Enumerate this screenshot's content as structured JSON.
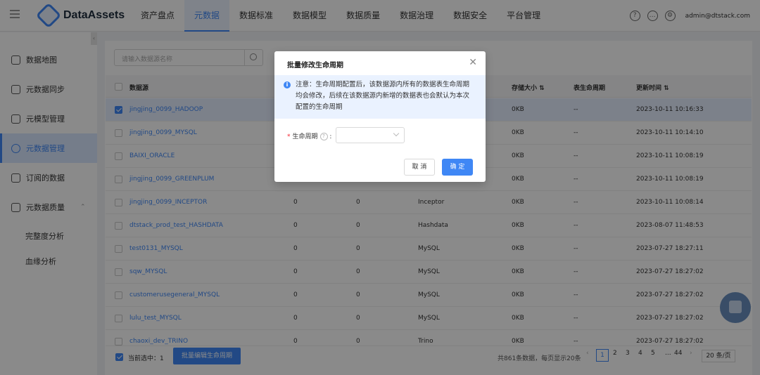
{
  "app": {
    "name": "DataAssets"
  },
  "nav": {
    "items": [
      "资产盘点",
      "元数据",
      "数据标准",
      "数据模型",
      "数据质量",
      "数据治理",
      "数据安全",
      "平台管理"
    ],
    "active_index": 1
  },
  "user": {
    "email": "admin@dtstack.com"
  },
  "sidebar": {
    "items": [
      {
        "label": "数据地图",
        "icon": "map-icon"
      },
      {
        "label": "元数据同步",
        "icon": "sync-icon"
      },
      {
        "label": "元模型管理",
        "icon": "cube-icon"
      },
      {
        "label": "元数据管理",
        "icon": "database-icon"
      },
      {
        "label": "订阅的数据",
        "icon": "subscribe-icon"
      },
      {
        "label": "元数据质量",
        "icon": "shield-icon"
      }
    ],
    "active_index": 3,
    "sub_items": [
      "完整度分析",
      "血缘分析"
    ]
  },
  "search": {
    "placeholder": "请输入数据源名称"
  },
  "table": {
    "columns": {
      "source": "数据源",
      "storage": "存储大小",
      "lifecycle": "表生命周期",
      "updated": "更新时间"
    },
    "rows": [
      {
        "name": "jingjing_0099_HADOOP",
        "c1": "",
        "c2": "",
        "type": "",
        "size": "0KB",
        "life": "--",
        "time": "2023-10-11 10:16:33",
        "checked": true
      },
      {
        "name": "jingjing_0099_MYSQL",
        "c1": "",
        "c2": "",
        "type": "",
        "size": "0KB",
        "life": "--",
        "time": "2023-10-11 10:14:10",
        "checked": false
      },
      {
        "name": "BAIXI_ORACLE",
        "c1": "",
        "c2": "",
        "type": "",
        "size": "0KB",
        "life": "--",
        "time": "2023-10-11 10:08:19",
        "checked": false
      },
      {
        "name": "jingjing_0099_GREENPLUM",
        "c1": "",
        "c2": "",
        "type": "",
        "size": "0KB",
        "life": "--",
        "time": "2023-10-11 10:08:19",
        "checked": false
      },
      {
        "name": "jingjing_0099_INCEPTOR",
        "c1": "0",
        "c2": "0",
        "type": "Inceptor",
        "size": "0KB",
        "life": "--",
        "time": "2023-10-11 10:08:14",
        "checked": false
      },
      {
        "name": "dtstack_prod_test_HASHDATA",
        "c1": "0",
        "c2": "0",
        "type": "Hashdata",
        "size": "0KB",
        "life": "--",
        "time": "2023-08-07 11:48:53",
        "checked": false
      },
      {
        "name": "test0131_MYSQL",
        "c1": "0",
        "c2": "0",
        "type": "MySQL",
        "size": "0KB",
        "life": "--",
        "time": "2023-07-27 18:27:11",
        "checked": false
      },
      {
        "name": "sqw_MYSQL",
        "c1": "0",
        "c2": "0",
        "type": "MySQL",
        "size": "0KB",
        "life": "--",
        "time": "2023-07-27 18:27:02",
        "checked": false
      },
      {
        "name": "customerusegeneral_MYSQL",
        "c1": "0",
        "c2": "0",
        "type": "MySQL",
        "size": "0KB",
        "life": "--",
        "time": "2023-07-27 18:27:02",
        "checked": false
      },
      {
        "name": "lulu_test_MYSQL",
        "c1": "0",
        "c2": "0",
        "type": "MySQL",
        "size": "0KB",
        "life": "--",
        "time": "2023-07-27 18:27:02",
        "checked": false
      },
      {
        "name": "chaoxi_dev_TRINO",
        "c1": "0",
        "c2": "0",
        "type": "Trino",
        "size": "0KB",
        "life": "--",
        "time": "2023-07-27 18:27:02",
        "checked": false
      }
    ]
  },
  "footer": {
    "selected": "当前选中：1",
    "batch_button": "批量编辑生命周期",
    "summary": "共861条数据，每页显示20条",
    "pages": [
      "1",
      "2",
      "3",
      "4",
      "5",
      "...",
      "44"
    ],
    "page_size": "20 条/页"
  },
  "modal": {
    "title": "批量修改生命周期",
    "notice": "注意：生命周期配置后，该数据源内所有的数据表生命周期均会修改，后续在该数据源内新增的数据表也会默认为本次配置的生命周期",
    "field_label": "生命周期",
    "cancel": "取 消",
    "ok": "确 定"
  }
}
